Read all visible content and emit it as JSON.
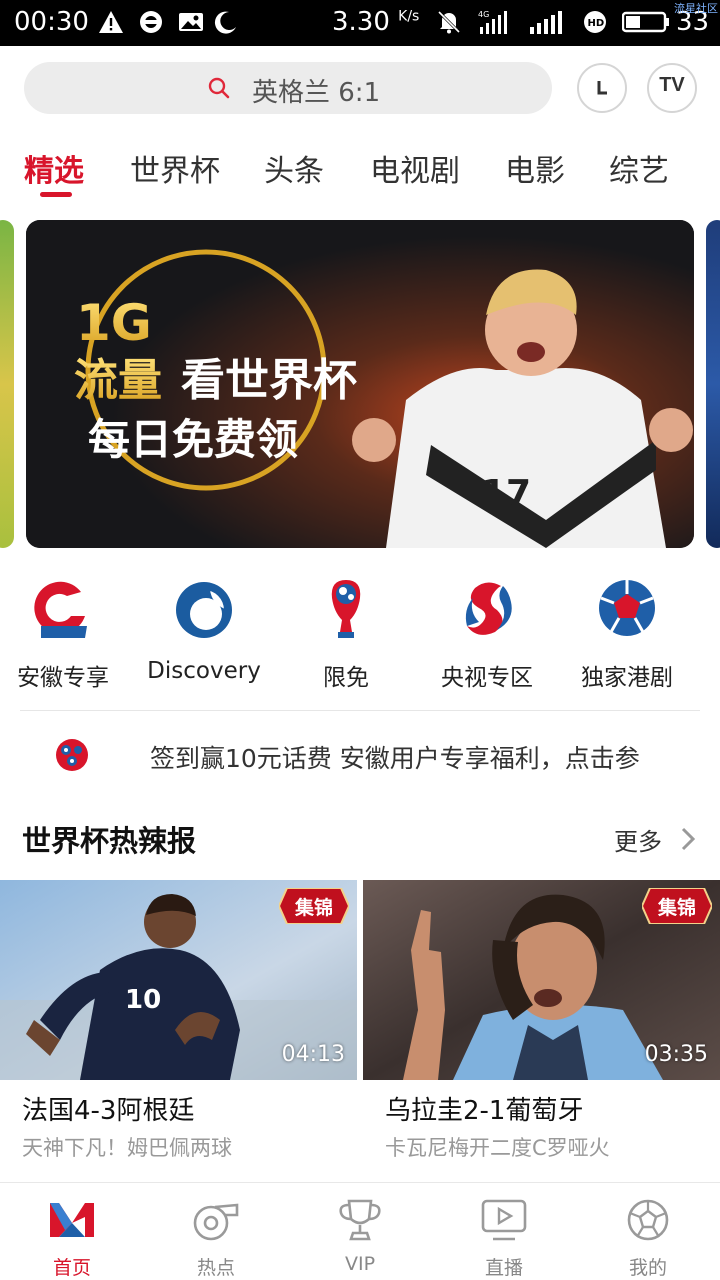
{
  "status_bar": {
    "time": "00:30",
    "net_speed": "3.30",
    "net_speed_unit": "K/s",
    "network_type": "4G",
    "battery": "33",
    "watermark": "流星社区"
  },
  "header": {
    "search_placeholder": "英格兰 6:1",
    "history_button_label": "L",
    "tv_button_label": "TV"
  },
  "tabs": [
    {
      "label": "精选",
      "active": true
    },
    {
      "label": "世界杯",
      "active": false
    },
    {
      "label": "头条",
      "active": false
    },
    {
      "label": "电视剧",
      "active": false
    },
    {
      "label": "电影",
      "active": false
    },
    {
      "label": "综艺",
      "active": false
    }
  ],
  "banner": {
    "line1_a": "1G",
    "line1_b": "流量",
    "line1_c": "看世界杯",
    "line2": "每日免费领",
    "jersey_number": "17"
  },
  "shortcuts": [
    {
      "label": "安徽专享",
      "icon": "anhui-logo-icon"
    },
    {
      "label": "Discovery",
      "icon": "discovery-logo-icon"
    },
    {
      "label": "限免",
      "icon": "world-cup-trophy-icon"
    },
    {
      "label": "央视专区",
      "icon": "cctv-logo-icon"
    },
    {
      "label": "独家港剧",
      "icon": "tvb-ball-icon"
    }
  ],
  "notice": {
    "text": "签到赢10元话费  安徽用户专享福利，点击参"
  },
  "section": {
    "title": "世界杯热辣报",
    "more_label": "更多"
  },
  "videos": [
    {
      "badge": "集锦",
      "duration": "04:13",
      "title": "法国4-3阿根廷",
      "subtitle": "天神下凡！姆巴佩两球",
      "jersey": "10"
    },
    {
      "badge": "集锦",
      "duration": "03:35",
      "title": "乌拉圭2-1葡萄牙",
      "subtitle": "卡瓦尼梅开二度C罗哑火"
    }
  ],
  "bottom_nav": [
    {
      "label": "首页",
      "icon": "home-logo-icon",
      "active": true
    },
    {
      "label": "热点",
      "icon": "whistle-icon",
      "active": false
    },
    {
      "label": "VIP",
      "icon": "trophy-icon",
      "active": false
    },
    {
      "label": "直播",
      "icon": "live-tv-icon",
      "active": false
    },
    {
      "label": "我的",
      "icon": "soccer-ball-icon",
      "active": false
    }
  ],
  "colors": {
    "accent": "#d8152b",
    "text_gray": "#999999",
    "search_bg": "#ececec"
  }
}
